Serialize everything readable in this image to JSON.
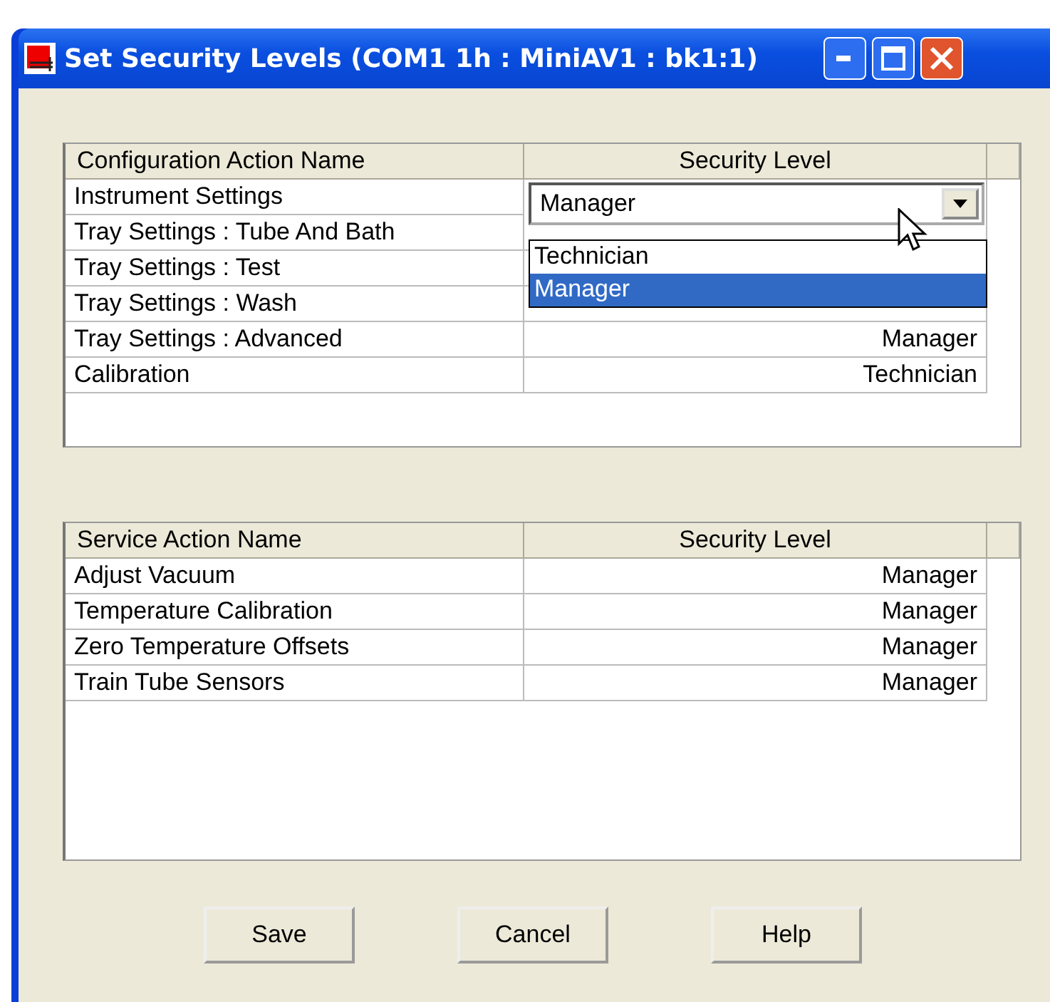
{
  "window": {
    "title": "Set Security Levels (COM1 1h : MiniAV1 : bk1:1)"
  },
  "configuration_table": {
    "columns": [
      "Configuration Action Name",
      "Security Level"
    ],
    "rows": [
      {
        "name": "Instrument Settings",
        "kind": "combo",
        "value": "Manager",
        "options": [
          {
            "label": "Technician",
            "selected": false
          },
          {
            "label": "Manager",
            "selected": true
          }
        ]
      },
      {
        "name": "Tray Settings : Tube And Bath",
        "kind": "hidden"
      },
      {
        "name": "Tray Settings : Test",
        "kind": "hidden"
      },
      {
        "name": "Tray Settings : Wash",
        "kind": "hidden"
      },
      {
        "name": "Tray Settings : Advanced",
        "kind": "text",
        "level": "Manager"
      },
      {
        "name": "Calibration",
        "kind": "text",
        "level": "Technician"
      }
    ]
  },
  "service_table": {
    "columns": [
      "Service Action Name",
      "Security Level"
    ],
    "rows": [
      {
        "name": "Adjust Vacuum",
        "kind": "text",
        "level": "Manager"
      },
      {
        "name": "Temperature Calibration",
        "kind": "text",
        "level": "Manager"
      },
      {
        "name": "Zero Temperature Offsets",
        "kind": "text",
        "level": "Manager"
      },
      {
        "name": "Train Tube Sensors",
        "kind": "text",
        "level": "Manager"
      }
    ]
  },
  "buttons": [
    "Save",
    "Cancel",
    "Help"
  ]
}
